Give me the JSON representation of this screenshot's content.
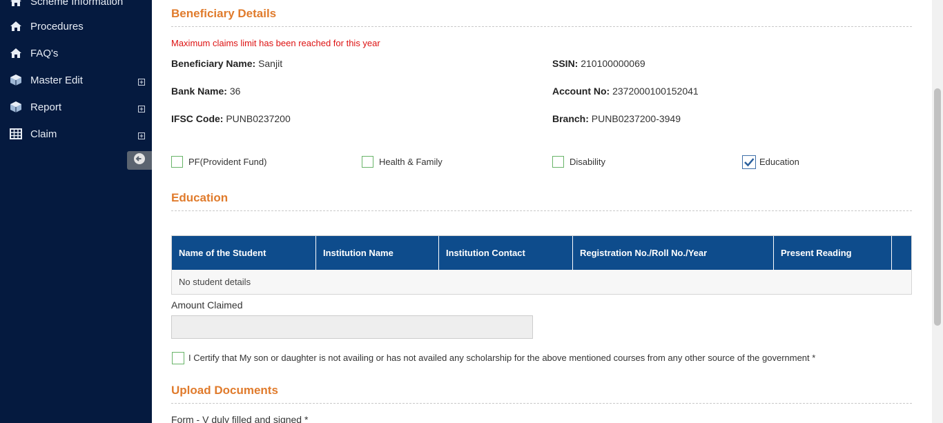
{
  "sidebar": {
    "items": [
      {
        "label": "Scheme Information",
        "icon": "home-icon"
      },
      {
        "label": "Procedures",
        "icon": "home-icon"
      },
      {
        "label": "FAQ's",
        "icon": "home-icon"
      },
      {
        "label": "Master Edit",
        "icon": "cube-icon",
        "expandable": true
      },
      {
        "label": "Report",
        "icon": "cube-icon",
        "expandable": true
      },
      {
        "label": "Claim",
        "icon": "table-icon",
        "expandable": true
      }
    ]
  },
  "beneficiary": {
    "title": "Beneficiary Details",
    "warning": "Maximum claims limit has been reached for this year",
    "name_label": "Beneficiary Name:",
    "name_value": "Sanjit",
    "ssin_label": "SSIN:",
    "ssin_value": "210100000069",
    "bank_label": "Bank Name:",
    "bank_value": "36",
    "account_label": "Account No:",
    "account_value": "2372000100152041",
    "ifsc_label": "IFSC Code:",
    "ifsc_value": "PUNB0237200",
    "branch_label": "Branch:",
    "branch_value": "PUNB0237200-3949"
  },
  "claim_types": [
    {
      "label": "PF(Provident Fund)",
      "checked": false
    },
    {
      "label": "Health & Family",
      "checked": false
    },
    {
      "label": "Disability",
      "checked": false
    },
    {
      "label": "Education",
      "checked": true
    }
  ],
  "education": {
    "title": "Education",
    "columns": [
      "Name of the Student",
      "Institution Name",
      "Institution Contact",
      "Registration No./Roll No./Year",
      "Present Reading",
      ""
    ],
    "empty_text": "No student details",
    "amount_label": "Amount Claimed",
    "amount_value": "",
    "certify_text": "I Certify that My son or daughter is not availing or has not availed any scholarship for the above mentioned courses from any other source of the government *"
  },
  "upload": {
    "title": "Upload Documents",
    "form_label": "Form - V duly filled and signed *"
  },
  "colors": {
    "sidebar_bg": "#051a3f",
    "accent": "#e07b2c",
    "table_header": "#0e4c8c",
    "warning": "#dd1111"
  }
}
